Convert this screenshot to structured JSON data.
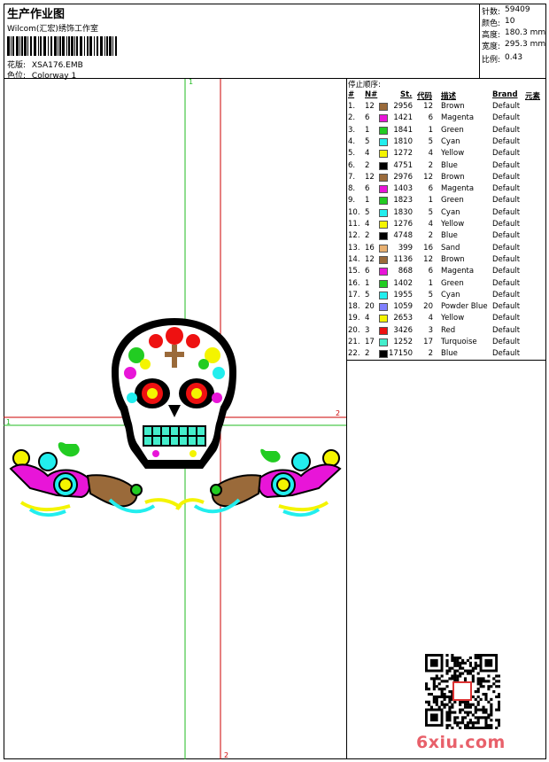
{
  "header": {
    "title": "生产作业图",
    "company": "Wilcom(汇宏)绣饰工作室",
    "design_label": "花版:",
    "design_value": "XSA176.EMB",
    "colorway_label": "色位:",
    "colorway_value": "Colorway 1"
  },
  "stats": [
    {
      "label": "针数:",
      "value": "59409"
    },
    {
      "label": "颜色:",
      "value": "10"
    },
    {
      "label": "高度:",
      "value": "180.3 mm"
    },
    {
      "label": "宽度:",
      "value": "295.3 mm"
    },
    {
      "label": "比例:",
      "value": "0.43"
    }
  ],
  "stop_sequence_label": "停止顺序:",
  "table": {
    "headers": {
      "index": "#",
      "n": "N#",
      "stitches": "St.",
      "code": "代码",
      "desc": "描述",
      "brand": "Brand",
      "element": "元素"
    },
    "rows": [
      {
        "i": "1.",
        "n": "12",
        "color": "#9a6a3a",
        "st": "2956",
        "code": "12",
        "desc": "Brown",
        "brand": "Default"
      },
      {
        "i": "2.",
        "n": "6",
        "color": "#e815d8",
        "st": "1421",
        "code": "6",
        "desc": "Magenta",
        "brand": "Default"
      },
      {
        "i": "3.",
        "n": "1",
        "color": "#22cc22",
        "st": "1841",
        "code": "1",
        "desc": "Green",
        "brand": "Default"
      },
      {
        "i": "4.",
        "n": "5",
        "color": "#22eeee",
        "st": "1810",
        "code": "5",
        "desc": "Cyan",
        "brand": "Default"
      },
      {
        "i": "5.",
        "n": "4",
        "color": "#f4f400",
        "st": "1272",
        "code": "4",
        "desc": "Yellow",
        "brand": "Default"
      },
      {
        "i": "6.",
        "n": "2",
        "color": "#000000",
        "st": "4751",
        "code": "2",
        "desc": "Blue",
        "brand": "Default"
      },
      {
        "i": "7.",
        "n": "12",
        "color": "#9a6a3a",
        "st": "2976",
        "code": "12",
        "desc": "Brown",
        "brand": "Default"
      },
      {
        "i": "8.",
        "n": "6",
        "color": "#e815d8",
        "st": "1403",
        "code": "6",
        "desc": "Magenta",
        "brand": "Default"
      },
      {
        "i": "9.",
        "n": "1",
        "color": "#22cc22",
        "st": "1823",
        "code": "1",
        "desc": "Green",
        "brand": "Default"
      },
      {
        "i": "10.",
        "n": "5",
        "color": "#22eeee",
        "st": "1830",
        "code": "5",
        "desc": "Cyan",
        "brand": "Default"
      },
      {
        "i": "11.",
        "n": "4",
        "color": "#f4f400",
        "st": "1276",
        "code": "4",
        "desc": "Yellow",
        "brand": "Default"
      },
      {
        "i": "12.",
        "n": "2",
        "color": "#000000",
        "st": "4748",
        "code": "2",
        "desc": "Blue",
        "brand": "Default"
      },
      {
        "i": "13.",
        "n": "16",
        "color": "#e8b070",
        "st": "399",
        "code": "16",
        "desc": "Sand",
        "brand": "Default"
      },
      {
        "i": "14.",
        "n": "12",
        "color": "#9a6a3a",
        "st": "1136",
        "code": "12",
        "desc": "Brown",
        "brand": "Default"
      },
      {
        "i": "15.",
        "n": "6",
        "color": "#e815d8",
        "st": "868",
        "code": "6",
        "desc": "Magenta",
        "brand": "Default"
      },
      {
        "i": "16.",
        "n": "1",
        "color": "#22cc22",
        "st": "1402",
        "code": "1",
        "desc": "Green",
        "brand": "Default"
      },
      {
        "i": "17.",
        "n": "5",
        "color": "#22eeee",
        "st": "1955",
        "code": "5",
        "desc": "Cyan",
        "brand": "Default"
      },
      {
        "i": "18.",
        "n": "20",
        "color": "#8080ff",
        "st": "1059",
        "code": "20",
        "desc": "Powder Blue",
        "brand": "Default"
      },
      {
        "i": "19.",
        "n": "4",
        "color": "#f4f400",
        "st": "2653",
        "code": "4",
        "desc": "Yellow",
        "brand": "Default"
      },
      {
        "i": "20.",
        "n": "3",
        "color": "#ee1111",
        "st": "3426",
        "code": "3",
        "desc": "Red",
        "brand": "Default"
      },
      {
        "i": "21.",
        "n": "17",
        "color": "#44eecc",
        "st": "1252",
        "code": "17",
        "desc": "Turquoise",
        "brand": "Default"
      },
      {
        "i": "22.",
        "n": "2",
        "color": "#000000",
        "st": "17150",
        "code": "2",
        "desc": "Blue",
        "brand": "Default"
      }
    ]
  },
  "guides": {
    "top_mark": "1",
    "right_mark": "2",
    "left_mark": "1",
    "bottom_mark": "2"
  },
  "watermark": "6xiu.com"
}
